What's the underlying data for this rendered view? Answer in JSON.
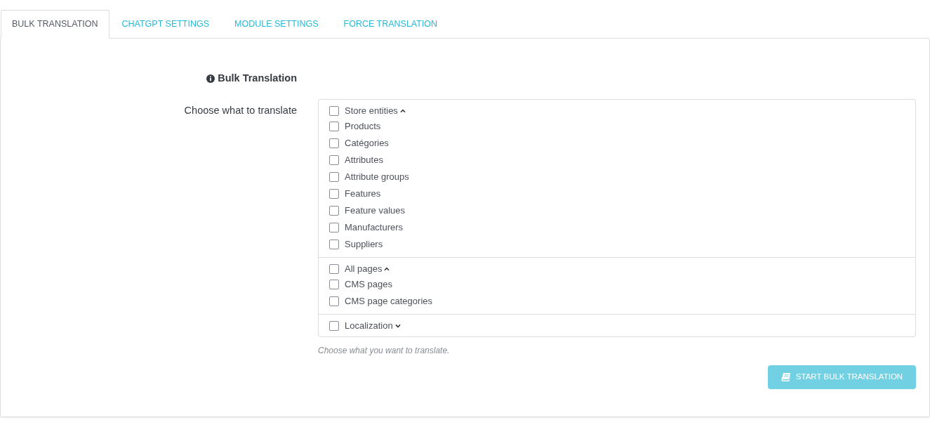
{
  "tabs": [
    {
      "label": "BULK TRANSLATION",
      "selected": true
    },
    {
      "label": "CHATGPT SETTINGS",
      "selected": false
    },
    {
      "label": "MODULE SETTINGS",
      "selected": false
    },
    {
      "label": "FORCE TRANSLATION",
      "selected": false
    }
  ],
  "panel": {
    "heading": "Bulk Translation",
    "field_label": "Choose what to translate",
    "help": "Choose what you want to translate.",
    "groups": [
      {
        "label": "Store entities",
        "checked": false,
        "expanded": true,
        "items": [
          {
            "label": "Products",
            "checked": false
          },
          {
            "label": "Catégories",
            "checked": false
          },
          {
            "label": "Attributes",
            "checked": false
          },
          {
            "label": "Attribute groups",
            "checked": false
          },
          {
            "label": "Features",
            "checked": false
          },
          {
            "label": "Feature values",
            "checked": false
          },
          {
            "label": "Manufacturers",
            "checked": false
          },
          {
            "label": "Suppliers",
            "checked": false
          }
        ]
      },
      {
        "label": "All pages",
        "checked": false,
        "expanded": true,
        "items": [
          {
            "label": "CMS pages",
            "checked": false
          },
          {
            "label": "CMS page categories",
            "checked": false
          }
        ]
      },
      {
        "label": "Localization",
        "checked": false,
        "expanded": false
      }
    ],
    "button": {
      "label": "START BULK TRANSLATION",
      "disabled": true
    }
  }
}
